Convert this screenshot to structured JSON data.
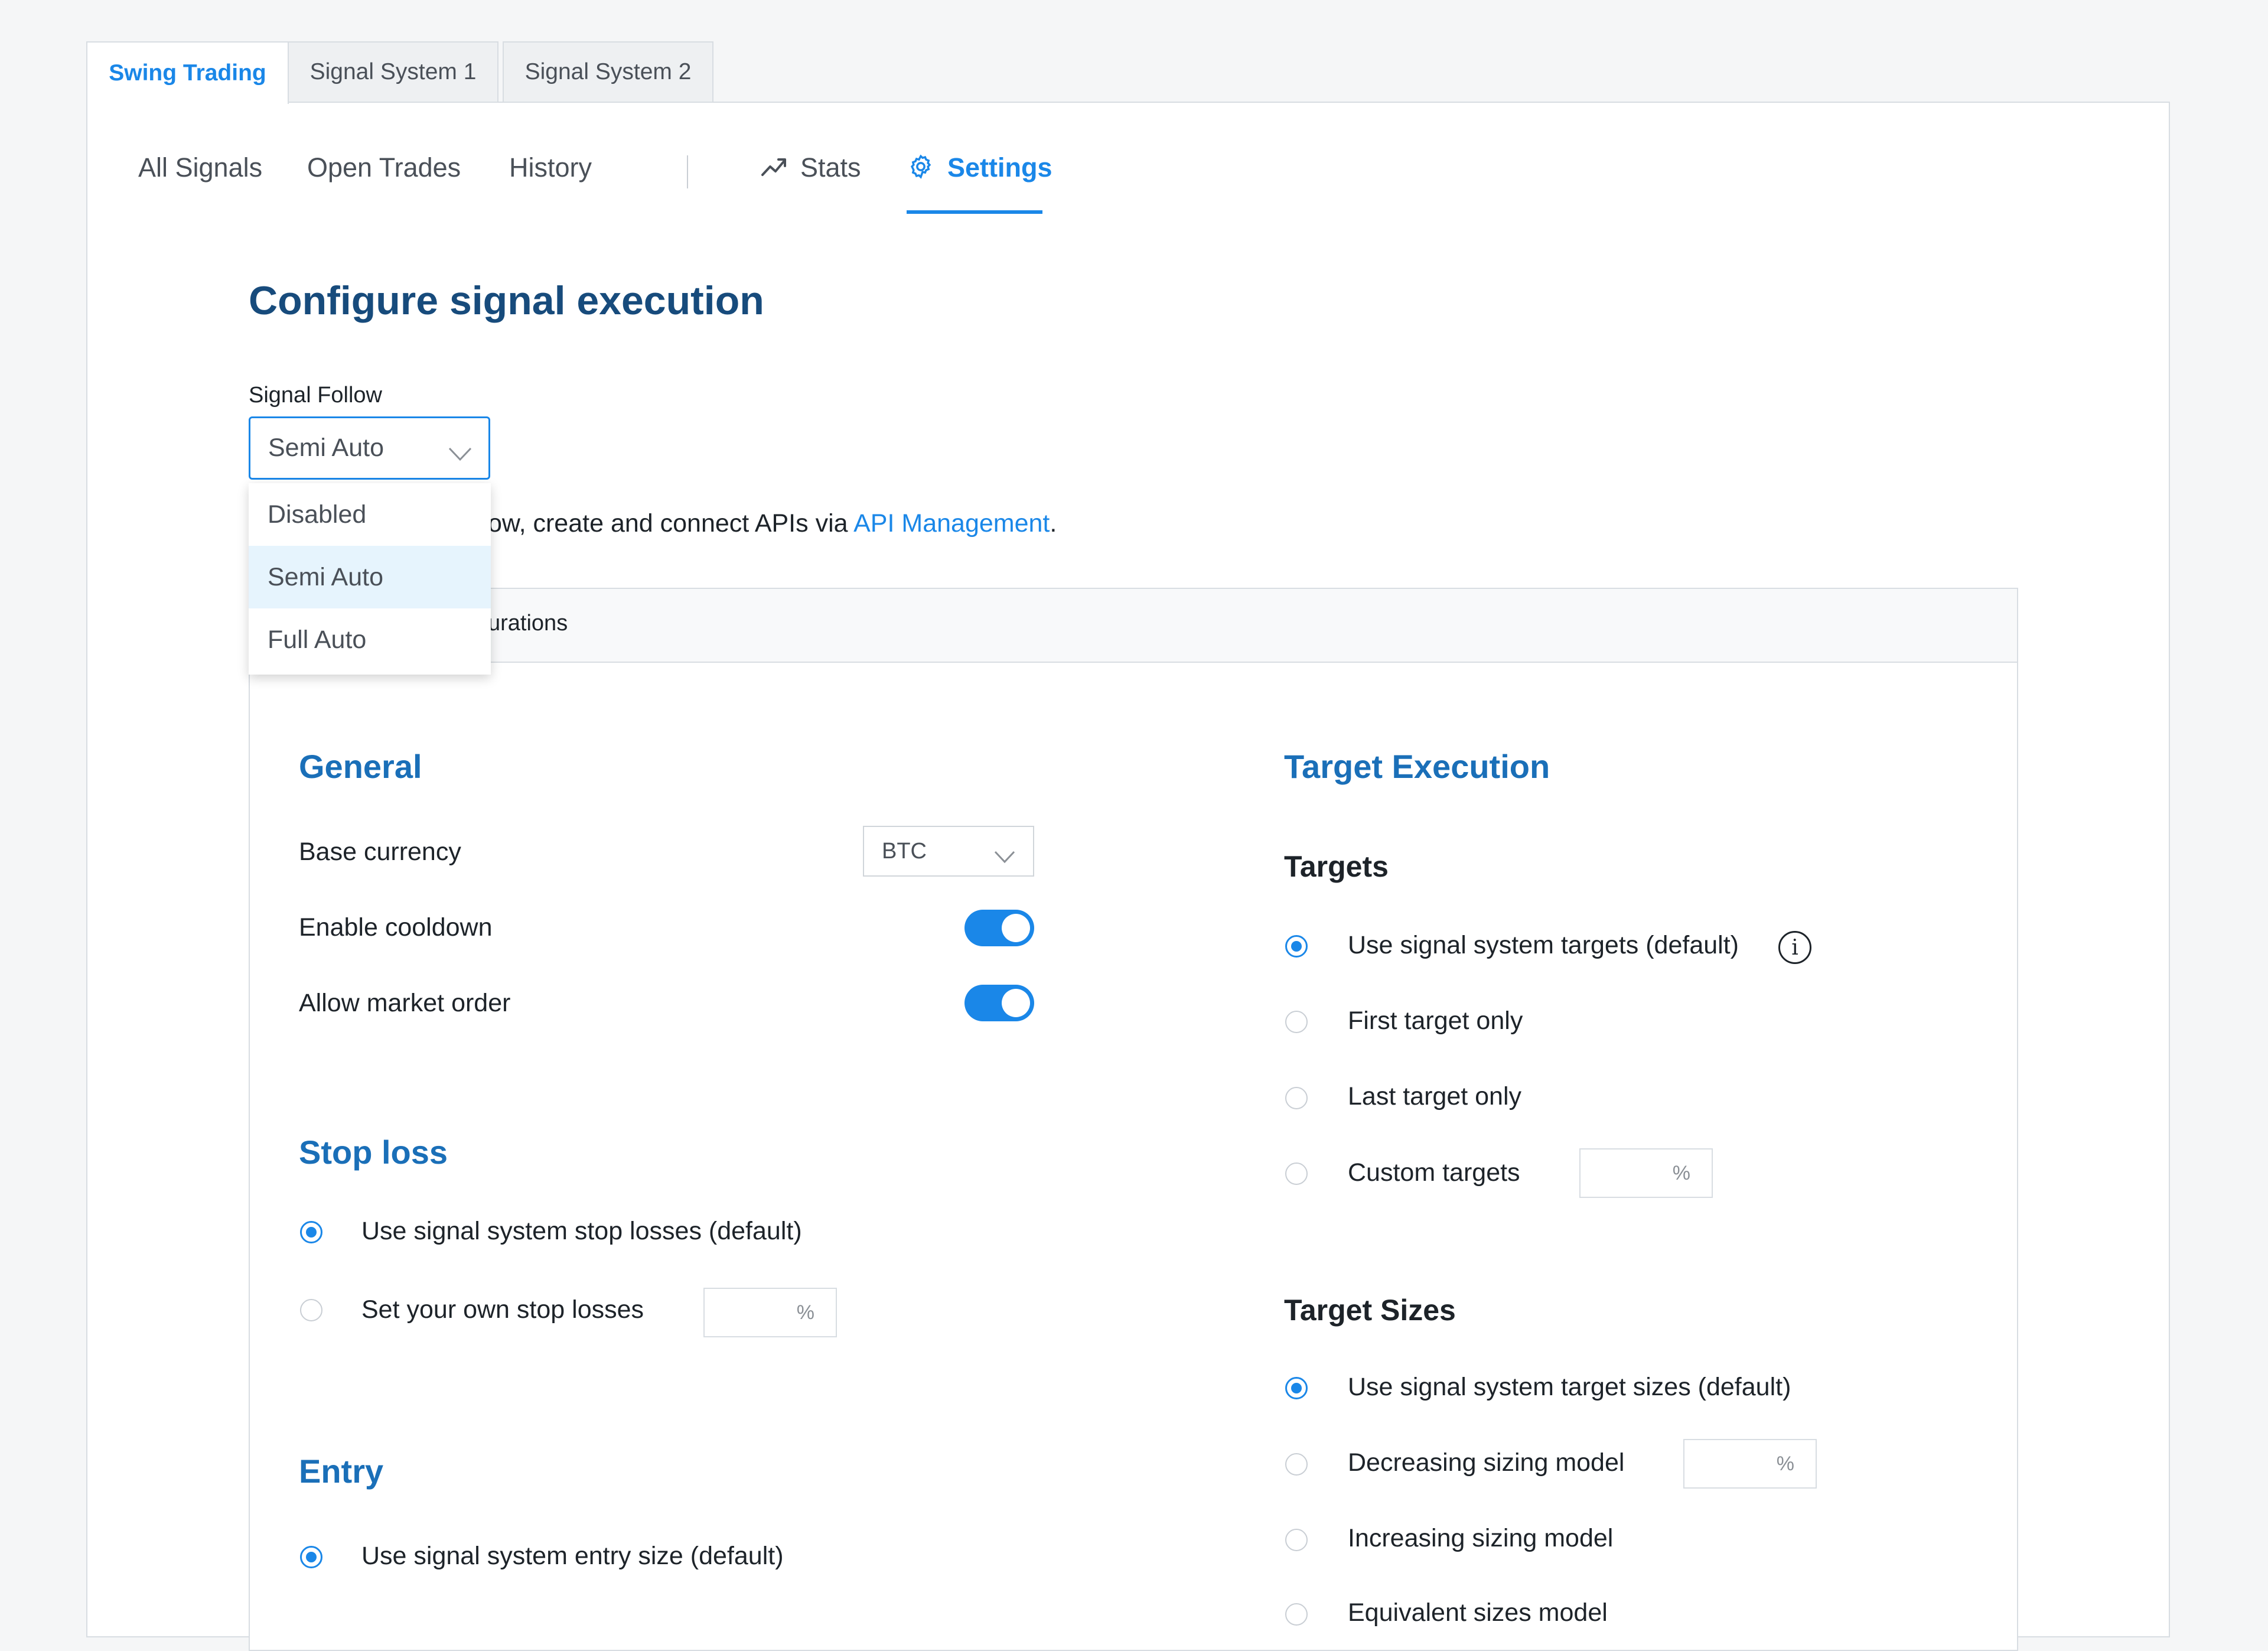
{
  "top_tabs": [
    {
      "label": "Swing Trading",
      "active": true
    },
    {
      "label": "Signal System 1",
      "active": false
    },
    {
      "label": "Signal System 2",
      "active": false
    }
  ],
  "subnav": {
    "all_signals": "All Signals",
    "open_trades": "Open Trades",
    "history": "History",
    "stats": "Stats",
    "settings": "Settings"
  },
  "page_title": "Configure signal execution",
  "signal_follow": {
    "label": "Signal Follow",
    "value": "Semi Auto",
    "options": [
      "Disabled",
      "Semi Auto",
      "Full Auto"
    ],
    "selected_index": 1
  },
  "api_hint": {
    "text_visible": "ow, create and connect APIs via ",
    "link": "API Management",
    "suffix": "."
  },
  "config_header_visible": "urations",
  "general": {
    "title": "General",
    "base_currency_label": "Base currency",
    "base_currency_value": "BTC",
    "enable_cooldown_label": "Enable cooldown",
    "enable_cooldown": true,
    "allow_market_order_label": "Allow market order",
    "allow_market_order": true
  },
  "stop_loss": {
    "title": "Stop loss",
    "options": [
      "Use signal system stop losses (default)",
      "Set your own stop losses"
    ],
    "selected_index": 0,
    "pct_suffix": "%"
  },
  "entry": {
    "title": "Entry",
    "options": [
      "Use signal system entry size (default)"
    ],
    "selected_index": 0
  },
  "target_execution": {
    "title": "Target Execution",
    "targets_title": "Targets",
    "targets": [
      "Use signal system targets (default)",
      "First target only",
      "Last target only",
      "Custom targets"
    ],
    "targets_selected_index": 0,
    "info_glyph": "i",
    "pct_suffix": "%",
    "sizes_title": "Target Sizes",
    "sizes": [
      "Use signal system target sizes (default)",
      "Decreasing sizing model",
      "Increasing sizing model",
      "Equivalent sizes model"
    ],
    "sizes_selected_index": 0
  },
  "colors": {
    "accent": "#1a87e8",
    "title": "#174b7c",
    "section_title": "#1a6fb8"
  },
  "icons": [
    "trend-up-icon",
    "gear-icon",
    "chevron-down-icon",
    "info-icon"
  ]
}
